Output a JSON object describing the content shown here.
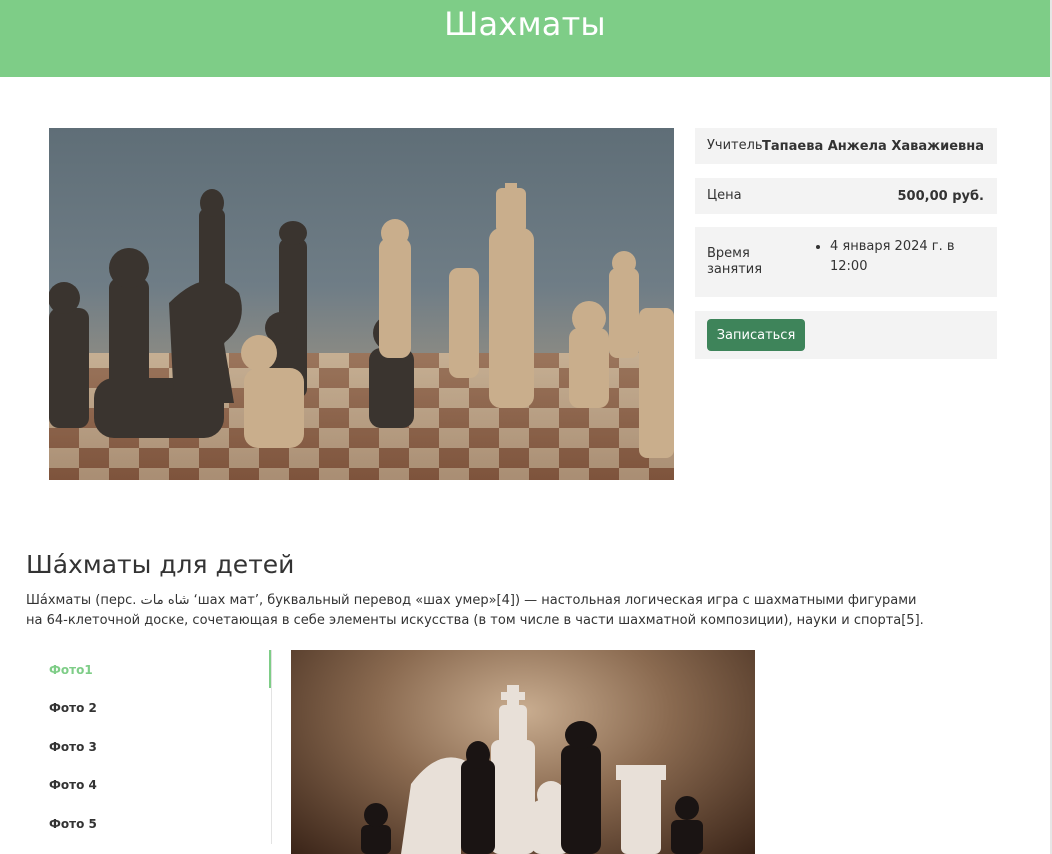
{
  "page": {
    "title": "Шахматы"
  },
  "info": {
    "teacher_label": "Учитель",
    "teacher_value": "Тапаева Анжела Хаважиевна",
    "price_label": "Цена",
    "price_value": "500,00 руб.",
    "time_label": "Время занятия",
    "time_items": [
      "4 января 2024 г. в 12:00"
    ],
    "signup_label": "Записаться"
  },
  "article": {
    "title": "Ша́хматы для детей",
    "text": "Ша́хматы (перс. شاه مات ‘шах мат’, буквальный перевод «шах умер»[4]) — настольная логическая игра с шахматными фигурами на 64-клеточной доске, сочетающая в себе элементы искусства (в том числе в части шахматной композиции), науки и спорта[5]."
  },
  "tabs": [
    {
      "label": "Фото1",
      "active": true
    },
    {
      "label": "Фото 2",
      "active": false
    },
    {
      "label": "Фото 3",
      "active": false
    },
    {
      "label": "Фото 4",
      "active": false
    },
    {
      "label": "Фото 5",
      "active": false
    }
  ],
  "colors": {
    "header_bg": "#7ecd87",
    "button_bg": "#3e845a",
    "active_tab": "#7ecd87",
    "panel_bg": "#f3f3f3"
  }
}
